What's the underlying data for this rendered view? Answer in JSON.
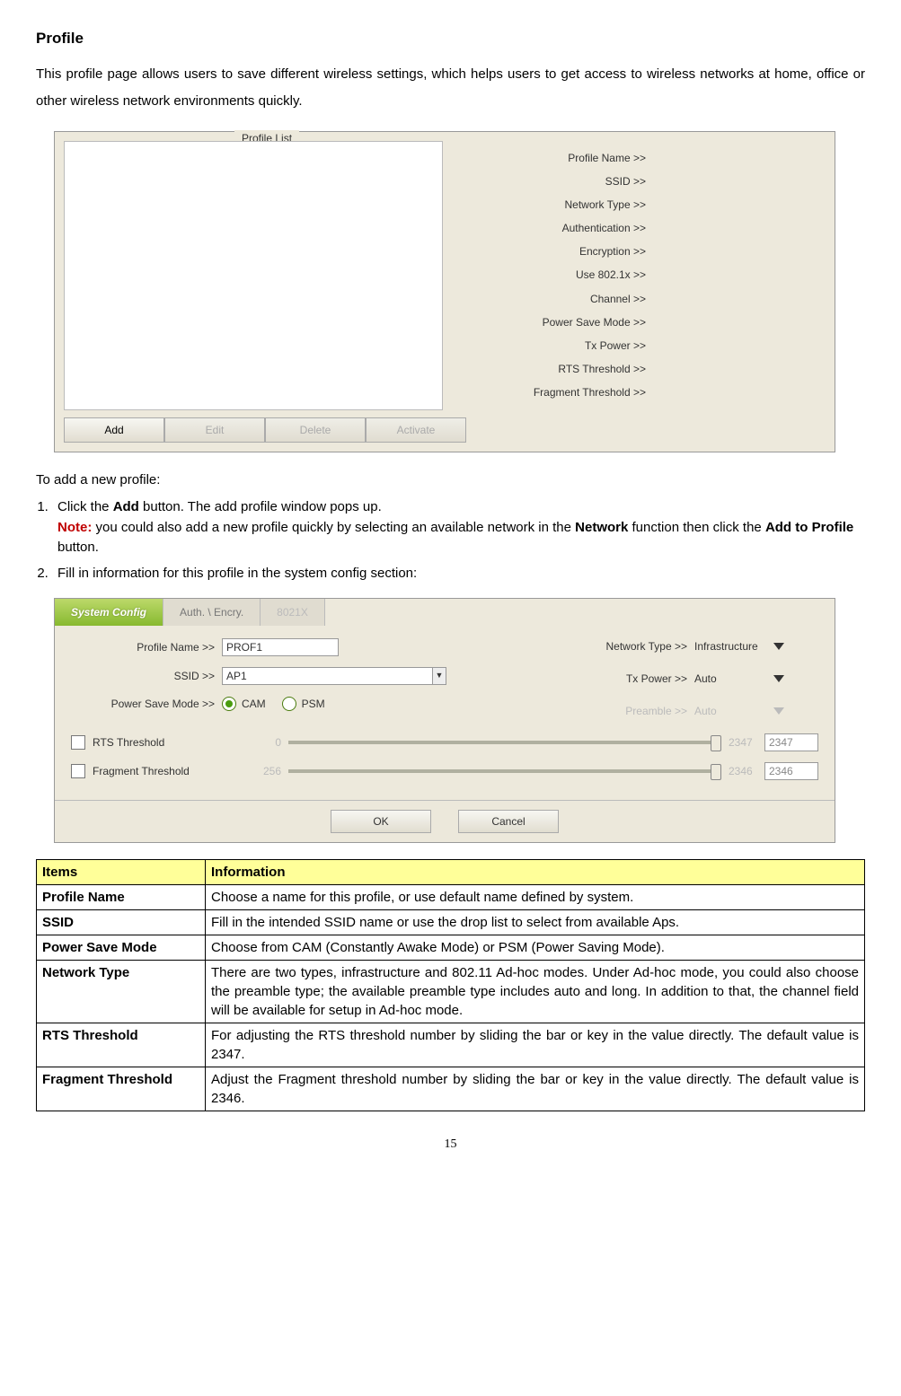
{
  "heading": "Profile",
  "intro": "This profile page allows users to save different wireless settings, which helps users to get access to wireless networks at home, office or other wireless network environments quickly.",
  "fig1": {
    "legend": "Profile List",
    "right_labels": [
      "Profile Name >>",
      "SSID >>",
      "Network Type >>",
      "Authentication >>",
      "Encryption >>",
      "Use 802.1x >>",
      "Channel >>",
      "Power Save Mode >>",
      "Tx Power >>",
      "RTS Threshold >>",
      "Fragment Threshold >>"
    ],
    "buttons": {
      "add": "Add",
      "edit": "Edit",
      "delete": "Delete",
      "activate": "Activate"
    }
  },
  "sub1": "To add a new profile:",
  "steps": {
    "s1a": "Click the ",
    "s1b": "Add",
    "s1c": " button. The add profile window pops up.",
    "note_label": "Note:",
    "note_body_a": " you could also add a new profile quickly by selecting an available network in the ",
    "note_body_b": "Network",
    "note_body_c": " function then click the ",
    "note_body_d": "Add to Profile",
    "note_body_e": " button.",
    "s2": "Fill in information for this profile in the system config section:"
  },
  "fig2": {
    "tabs": {
      "t1": "System Config",
      "t2": "Auth. \\ Encry.",
      "t3": "8021X"
    },
    "profile_name_lbl": "Profile Name >>",
    "profile_name_val": "PROF1",
    "ssid_lbl": "SSID >>",
    "ssid_val": "AP1",
    "psm_lbl": "Power Save Mode >>",
    "psm_cam": "CAM",
    "psm_psm": "PSM",
    "net_lbl": "Network Type >>",
    "net_val": "Infrastructure",
    "tx_lbl": "Tx Power >>",
    "tx_val": "Auto",
    "pre_lbl": "Preamble >>",
    "pre_val": "Auto",
    "rts_cb": "RTS Threshold",
    "rts_min": "0",
    "rts_max": "2347",
    "rts_val": "2347",
    "frag_cb": "Fragment Threshold",
    "frag_min": "256",
    "frag_max": "2346",
    "frag_val": "2346",
    "ok": "OK",
    "cancel": "Cancel"
  },
  "table": {
    "h1": "Items",
    "h2": "Information",
    "rows": [
      {
        "k": "Profile Name",
        "v": "Choose a name for this profile, or use default name defined by system."
      },
      {
        "k": "SSID",
        "v": "Fill in the intended SSID name or use the drop list to select from available Aps."
      },
      {
        "k": "Power Save Mode",
        "v": "Choose from CAM (Constantly Awake Mode) or PSM (Power Saving Mode)."
      },
      {
        "k": "Network Type",
        "v": "There are two types, infrastructure and 802.11 Ad-hoc modes. Under Ad-hoc mode, you could also choose the preamble type; the available preamble type includes auto and long. In addition to that, the channel field will be available for setup in Ad-hoc mode."
      },
      {
        "k": "RTS Threshold",
        "v": "For adjusting the RTS threshold number by sliding the bar or key in the value directly. The default value is 2347."
      },
      {
        "k": "Fragment Threshold",
        "v": "Adjust the Fragment threshold number by sliding the bar or key in the value directly. The default value is 2346."
      }
    ]
  },
  "page_number": "15"
}
